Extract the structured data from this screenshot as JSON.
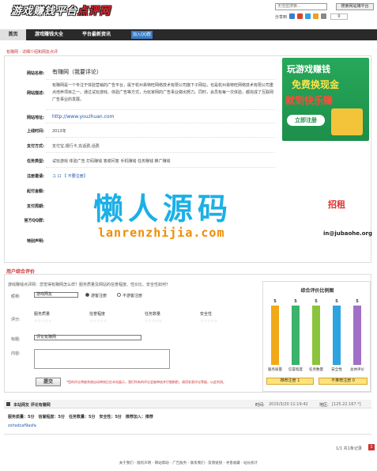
{
  "header": {
    "logo_text_a": "游戏赚钱平台",
    "logo_text_b": "点评网",
    "search_placeholder": "无佳蓝搜索...",
    "search_button": "搜索网站赚平台",
    "share_label": "分享到",
    "share_count": "0"
  },
  "nav": {
    "items": [
      "首页",
      "游戏赚钱大全",
      "平台最新资讯"
    ],
    "qq": "加入QQ群"
  },
  "breadcrumb": "有赚网 - 详细介绍和网友点评",
  "site": {
    "name_label": "网站名称:",
    "name_value": "有赚网（我要评论）",
    "desc_label": "网站描述:",
    "desc_value": "有赚网是一个专注于体验营销的广告平台，属于杭州易特旺网络技术有限公司旗下子网站，也是杭州易特旺网络技术有限公司重点培养项目之一。通过试玩游戏、体验广告等方式，为玩家网的广告事业做出努力。同时，会员有每一次体验，都完成了互联网广告事业的发展。",
    "url_label": "网站地址:",
    "url_value": "http://www.youzhuan.com",
    "online_label": "上线时间:",
    "online_value": "2013年",
    "pay_label": "支付方式:",
    "pay_value": "支付宝,银行卡,充话费,话费",
    "task_label": "任务类型:",
    "task_value": "试玩游戏 体验广告 打码赚钱 答谢问答 手机赚钱 任务赚钱 推广赚钱",
    "reg_label": "注册邀请:",
    "reg_value": "ユ ロ 【 不要注册】",
    "start_label": "起付金额:",
    "server_label": "支付周期:",
    "qq_label": "官方QQ群:",
    "special_label": "特别声明:"
  },
  "ad": {
    "line1": "玩游戏赚钱",
    "line2": "免费换现金",
    "line3": "就到快乐赚",
    "cta": "立即注册"
  },
  "partial_texts": {
    "recruit": "招租",
    "email": "in@jubaohe.org"
  },
  "watermark": {
    "cn": "懒人源码",
    "en": "lanrenzhijia.com"
  },
  "review_form": {
    "title": "用户综合评价",
    "prompt": "游戏赚钱点评网：您觉得有赚网怎么样？服务质量及网站的信誉程度、性价比、安全性如何？",
    "nick_label": "昵称:",
    "nick_value": "游戏网友",
    "radio_a": "游客注册",
    "radio_b": "不游客注册",
    "rate_label": "评分:",
    "rate_items": [
      "服务质量",
      "信誉程度",
      "任务数量",
      "安全性"
    ],
    "stars": "☆☆☆☆☆",
    "title_label": "标题:",
    "title_value": "评论有赚网",
    "content_label": "内容:",
    "submit": "提交",
    "note": "*您的评论将被系统自动审核后在本站展示，我们所有的评论会被审核并仔细斟酌，请用发表评论等级，以此利润。"
  },
  "chart_data": {
    "type": "bar",
    "title": "综合评价比例图",
    "categories": [
      "服务质量",
      "信誉程度",
      "任务数量",
      "安全性",
      "总体评价"
    ],
    "values": [
      5,
      5,
      5,
      5,
      5
    ],
    "ylim": [
      0,
      5
    ],
    "colors": [
      "#f2a918",
      "#3bb36a",
      "#8ac43c",
      "#2da4e0",
      "#a070c8"
    ],
    "buttons": [
      "推荐注册 1",
      "不推荐注册 0"
    ]
  },
  "reviews": {
    "header_title": "本站网友 评论有赚网",
    "time_label": "时间:",
    "time_value": "2015/3/20 11:19:42",
    "addr_label": "地区:",
    "addr_value": "[125.22.167.*]",
    "scores": "服务质量：5分　信誉程度：5分　任务数量：5分　安全性：5分　推荐加入：推荐",
    "user": "zxhsdcaf9asfa",
    "pager": "1/1 共1条记录",
    "page_current": "1"
  },
  "footer": {
    "links": "关于我们 - 版权声明 - 网站帮助 - 广告服务 - 联系我们 - 友情链接 - 寻香收藏 - 站长统计"
  }
}
